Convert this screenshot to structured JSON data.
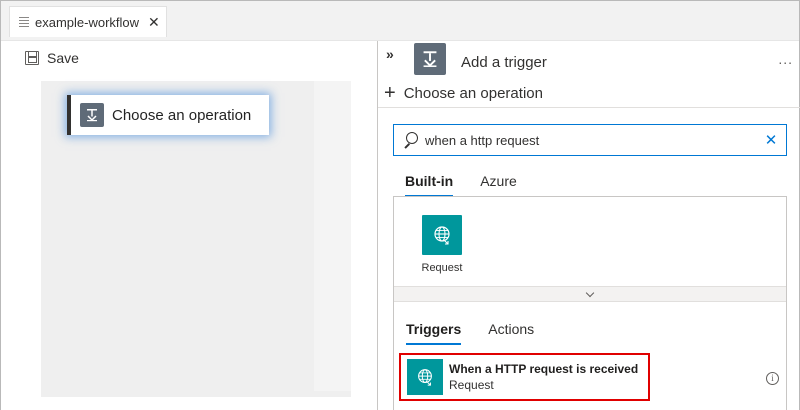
{
  "tab": {
    "title": "example-workflow",
    "close": "✕"
  },
  "toolbar": {
    "save_label": "Save"
  },
  "canvas": {
    "operation_card_label": "Choose an operation"
  },
  "panel": {
    "collapse_glyph": "»",
    "title": "Add a trigger",
    "more_glyph": "...",
    "choose_label": "Choose an operation",
    "search": {
      "value": "when a http request",
      "clear_glyph": "✕"
    },
    "source_tabs": [
      {
        "label": "Built-in",
        "active": true
      },
      {
        "label": "Azure",
        "active": false
      }
    ],
    "connectors": [
      {
        "label": "Request",
        "icon": "globe-icon",
        "color": "#00979c"
      }
    ],
    "result_tabs": [
      {
        "label": "Triggers",
        "active": true
      },
      {
        "label": "Actions",
        "active": false
      }
    ],
    "trigger": {
      "name": "When a HTTP request is received",
      "connector": "Request",
      "icon": "globe-icon",
      "highlight_color": "#e00000"
    },
    "info_glyph": "i"
  },
  "colors": {
    "accent": "#0078d4",
    "connector_teal": "#00979c",
    "operation_icon": "#5f6b78"
  }
}
